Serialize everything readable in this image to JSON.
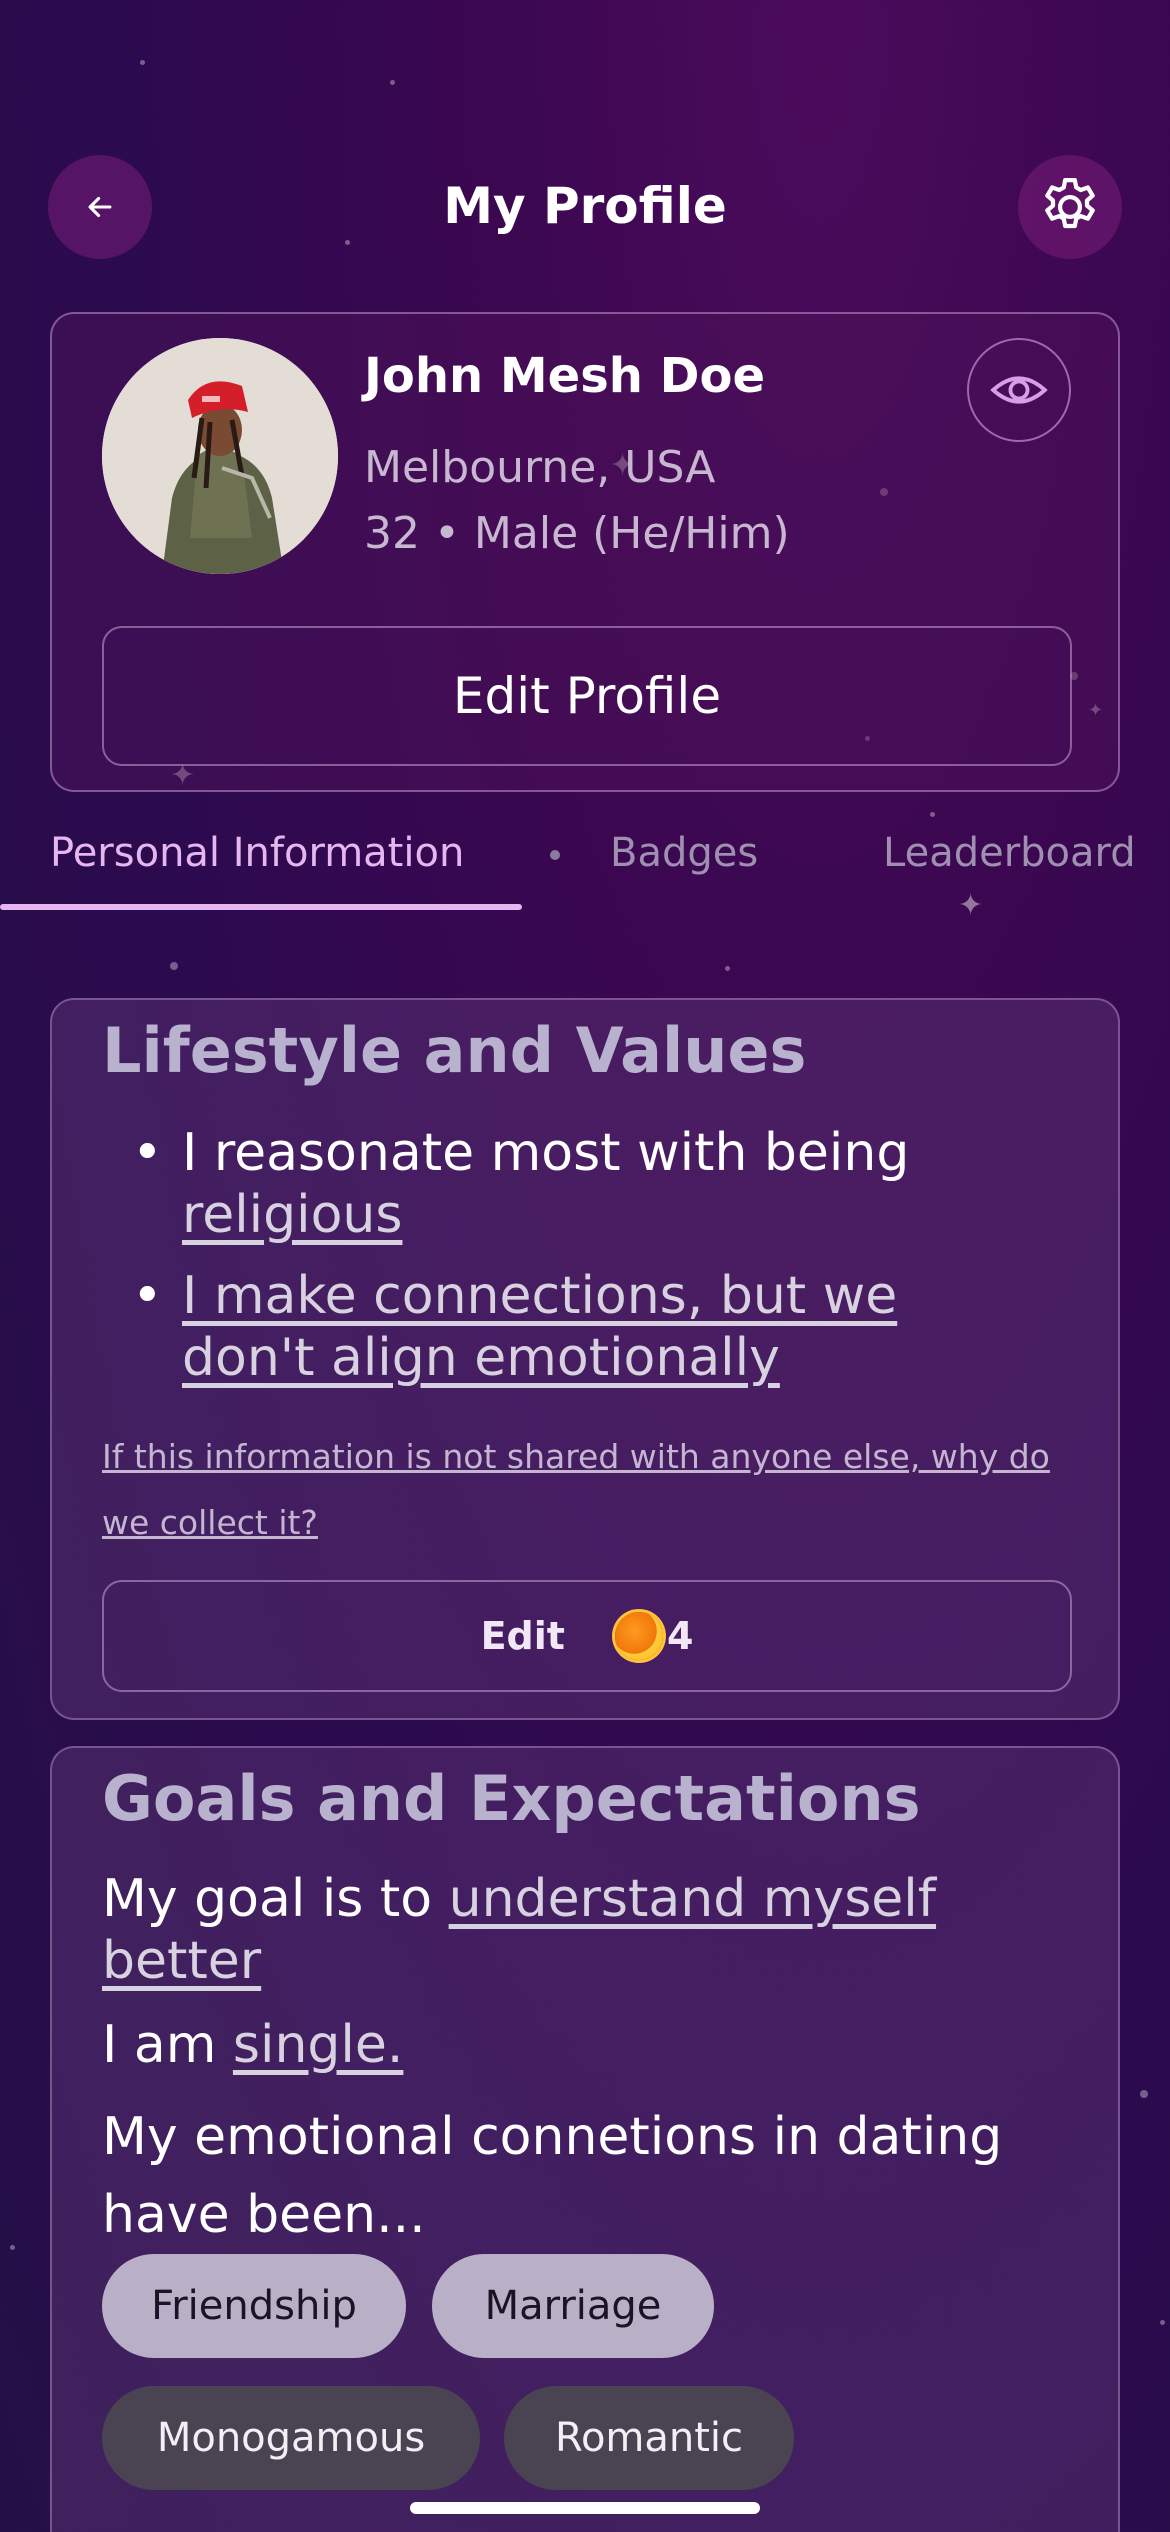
{
  "header": {
    "title": "My Profile",
    "back_icon": "back-arrow-icon",
    "settings_icon": "gear-icon"
  },
  "profile": {
    "name": "John Mesh Doe",
    "location": "Melbourne, USA",
    "details": "32 • Male (He/Him)",
    "visibility_icon": "eye-icon",
    "edit_label": "Edit Profile"
  },
  "tabs": [
    {
      "label": "Personal Information",
      "active": true
    },
    {
      "label": "Badges",
      "active": false
    },
    {
      "label": "Leaderboard",
      "active": false
    }
  ],
  "lifestyle": {
    "title": "Lifestyle and Values",
    "item1_text": "I reasonate most with being",
    "item1_link": "religious",
    "item2_link": "I make connections, but we don't align emotionally",
    "info_link": "If this information is not shared with anyone else, why do we collect it?",
    "edit_label": "Edit",
    "coin_count": "4"
  },
  "goals": {
    "title": "Goals and Expectations",
    "goal_prefix": "My goal is to",
    "goal_link": "understand myself better",
    "status_prefix": "I am",
    "status_link": "single.",
    "emotional_text": "My emotional connetions in dating have been...",
    "chips": [
      {
        "label": "Friendship",
        "selected": true
      },
      {
        "label": "Marriage",
        "selected": true
      },
      {
        "label": "Monogamous",
        "selected": false
      },
      {
        "label": "Romantic",
        "selected": false
      }
    ]
  },
  "colors": {
    "accent": "#e6b6f0",
    "background": "#2c0a4f",
    "coin": "#f0780a"
  }
}
